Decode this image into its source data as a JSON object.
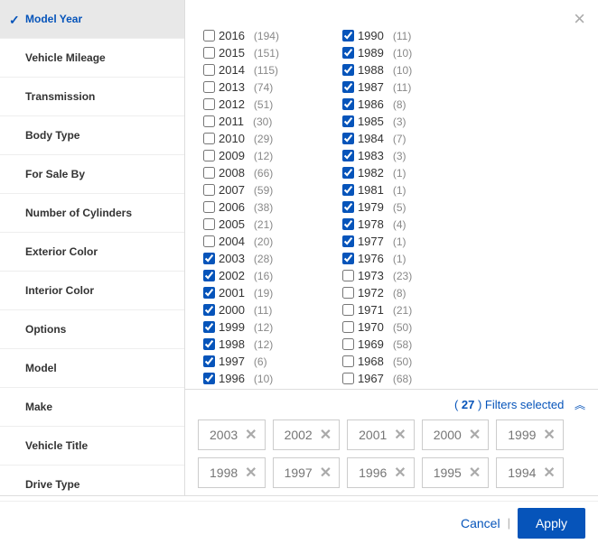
{
  "sidebar": {
    "items": [
      {
        "label": "Model Year",
        "active": true
      },
      {
        "label": "Vehicle Mileage"
      },
      {
        "label": "Transmission"
      },
      {
        "label": "Body Type"
      },
      {
        "label": "For Sale By"
      },
      {
        "label": "Number of Cylinders"
      },
      {
        "label": "Exterior Color"
      },
      {
        "label": "Interior Color"
      },
      {
        "label": "Options"
      },
      {
        "label": "Model"
      },
      {
        "label": "Make"
      },
      {
        "label": "Vehicle Title"
      },
      {
        "label": "Drive Type"
      }
    ]
  },
  "years_col1": [
    {
      "y": "2016",
      "c": "194",
      "checked": false
    },
    {
      "y": "2015",
      "c": "151",
      "checked": false
    },
    {
      "y": "2014",
      "c": "115",
      "checked": false
    },
    {
      "y": "2013",
      "c": "74",
      "checked": false
    },
    {
      "y": "2012",
      "c": "51",
      "checked": false
    },
    {
      "y": "2011",
      "c": "30",
      "checked": false
    },
    {
      "y": "2010",
      "c": "29",
      "checked": false
    },
    {
      "y": "2009",
      "c": "12",
      "checked": false
    },
    {
      "y": "2008",
      "c": "66",
      "checked": false
    },
    {
      "y": "2007",
      "c": "59",
      "checked": false
    },
    {
      "y": "2006",
      "c": "38",
      "checked": false
    },
    {
      "y": "2005",
      "c": "21",
      "checked": false
    },
    {
      "y": "2004",
      "c": "20",
      "checked": false
    },
    {
      "y": "2003",
      "c": "28",
      "checked": true
    },
    {
      "y": "2002",
      "c": "16",
      "checked": true
    },
    {
      "y": "2001",
      "c": "19",
      "checked": true
    },
    {
      "y": "2000",
      "c": "11",
      "checked": true
    },
    {
      "y": "1999",
      "c": "12",
      "checked": true
    },
    {
      "y": "1998",
      "c": "12",
      "checked": true
    },
    {
      "y": "1997",
      "c": "6",
      "checked": true
    },
    {
      "y": "1996",
      "c": "10",
      "checked": true
    }
  ],
  "years_col2": [
    {
      "y": "1990",
      "c": "11",
      "checked": true
    },
    {
      "y": "1989",
      "c": "10",
      "checked": true
    },
    {
      "y": "1988",
      "c": "10",
      "checked": true
    },
    {
      "y": "1987",
      "c": "11",
      "checked": true
    },
    {
      "y": "1986",
      "c": "8",
      "checked": true
    },
    {
      "y": "1985",
      "c": "3",
      "checked": true
    },
    {
      "y": "1984",
      "c": "7",
      "checked": true
    },
    {
      "y": "1983",
      "c": "3",
      "checked": true
    },
    {
      "y": "1982",
      "c": "1",
      "checked": true
    },
    {
      "y": "1981",
      "c": "1",
      "checked": true
    },
    {
      "y": "1979",
      "c": "5",
      "checked": true
    },
    {
      "y": "1978",
      "c": "4",
      "checked": true
    },
    {
      "y": "1977",
      "c": "1",
      "checked": true
    },
    {
      "y": "1976",
      "c": "1",
      "checked": true
    },
    {
      "y": "1973",
      "c": "23",
      "checked": false
    },
    {
      "y": "1972",
      "c": "8",
      "checked": false
    },
    {
      "y": "1971",
      "c": "21",
      "checked": false
    },
    {
      "y": "1970",
      "c": "50",
      "checked": false
    },
    {
      "y": "1969",
      "c": "58",
      "checked": false
    },
    {
      "y": "1968",
      "c": "50",
      "checked": false
    },
    {
      "y": "1967",
      "c": "68",
      "checked": false
    }
  ],
  "selected": {
    "count_prefix": "( ",
    "count": "27",
    "count_suffix": " ) Filters selected",
    "pills": [
      "2003",
      "2002",
      "2001",
      "2000",
      "1999",
      "1998",
      "1997",
      "1996",
      "1995",
      "1994"
    ]
  },
  "footer": {
    "cancel": "Cancel",
    "sep": "|",
    "apply": "Apply"
  }
}
